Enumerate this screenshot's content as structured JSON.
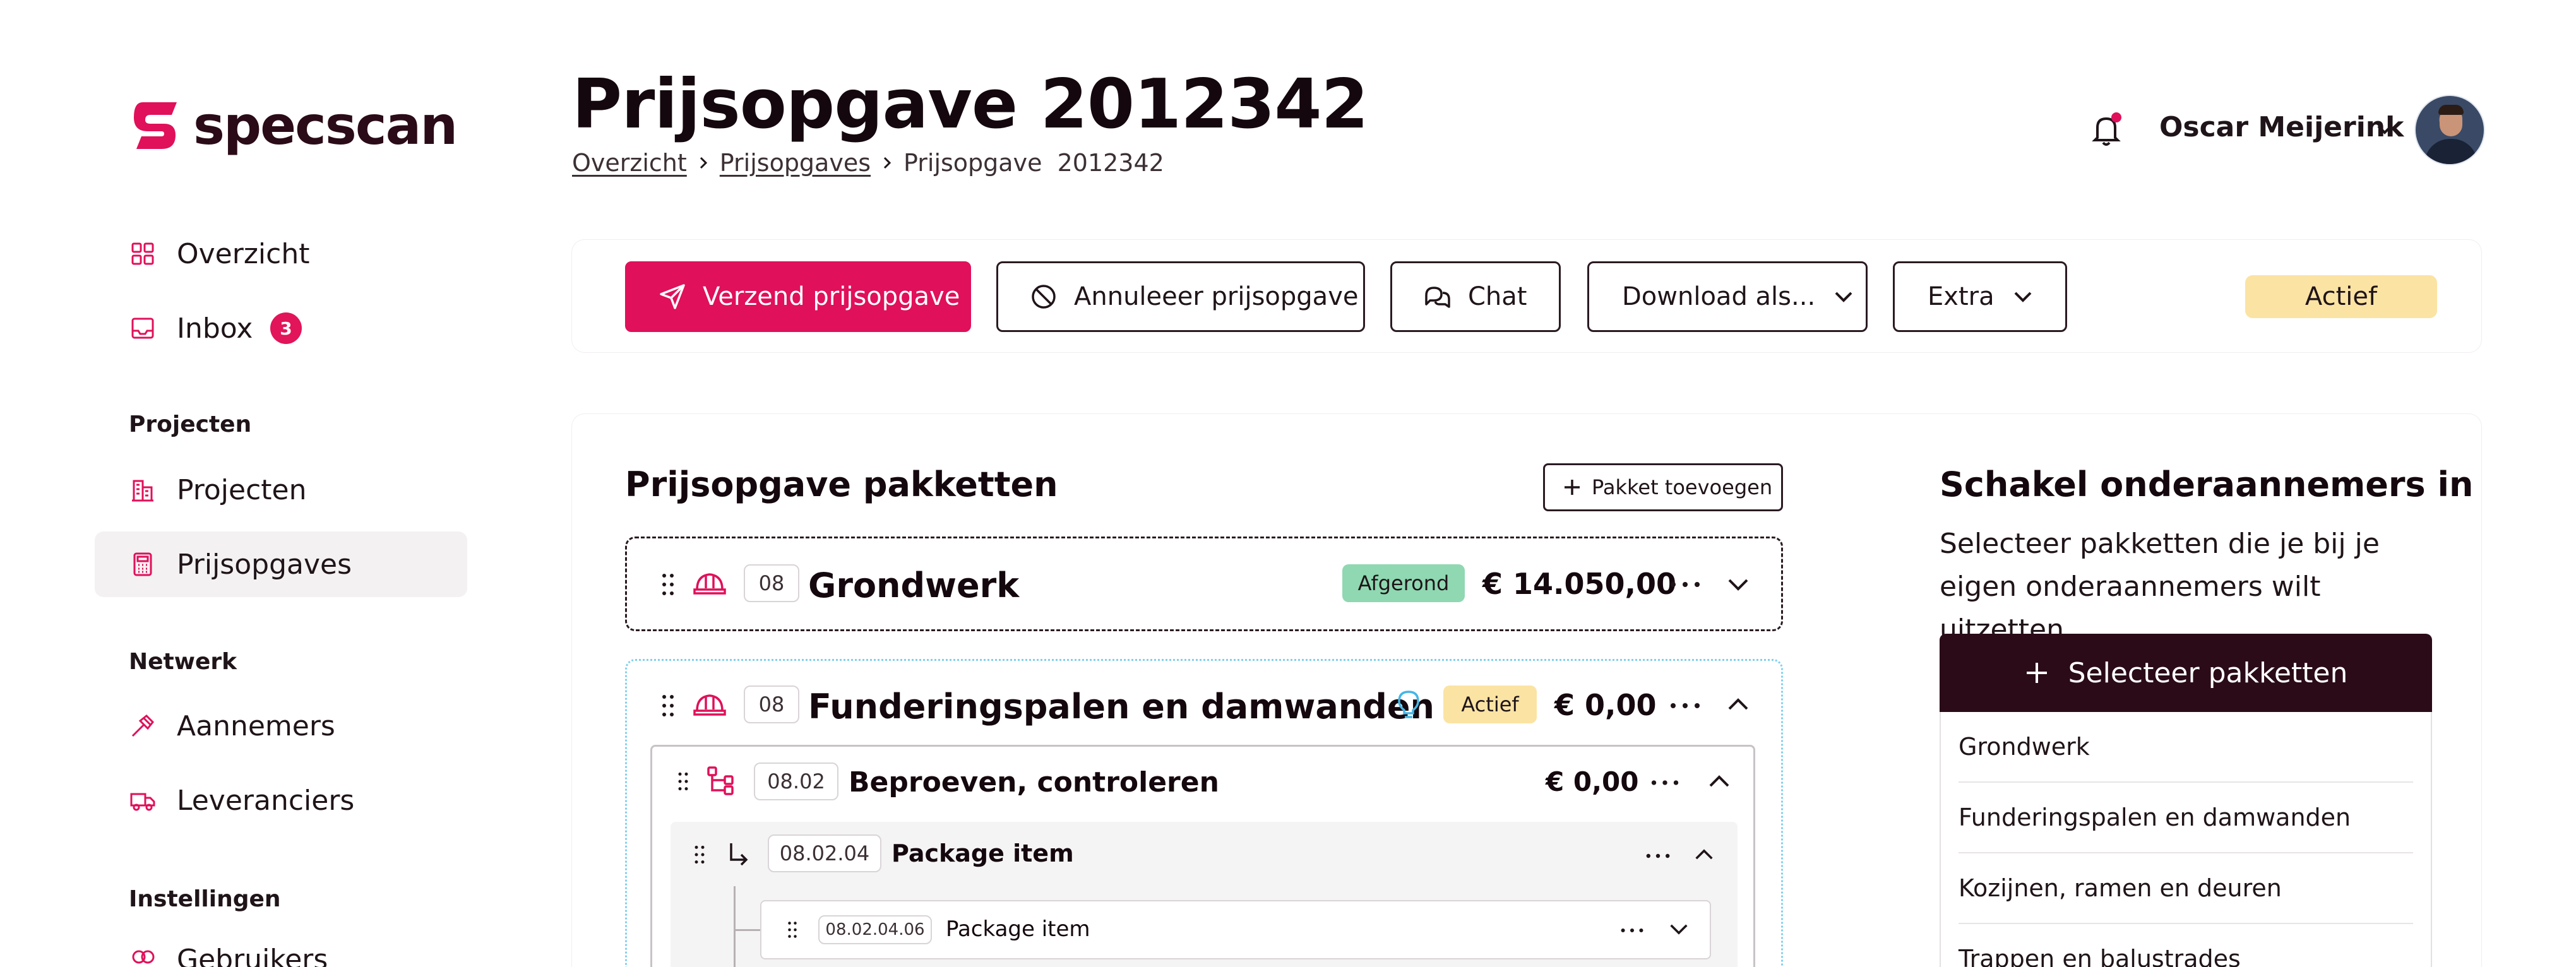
{
  "app": {
    "logo_text": "specscan"
  },
  "sidebar": {
    "items_top": [
      {
        "label": "Overzicht",
        "icon": "grid-icon"
      },
      {
        "label": "Inbox",
        "icon": "inbox-icon",
        "badge": "3"
      }
    ],
    "sections": [
      {
        "title": "Projecten",
        "items": [
          {
            "label": "Projecten",
            "icon": "buildings-icon"
          },
          {
            "label": "Prijsopgaves",
            "icon": "calculator-icon",
            "active": true
          }
        ]
      },
      {
        "title": "Netwerk",
        "items": [
          {
            "label": "Aannemers",
            "icon": "hammer-icon"
          },
          {
            "label": "Leveranciers",
            "icon": "truck-icon"
          }
        ]
      },
      {
        "title": "Instellingen",
        "items": [
          {
            "label": "Gebruikers",
            "icon": "users-icon"
          }
        ]
      }
    ]
  },
  "header": {
    "title": "Prijsopgave 2012342",
    "breadcrumb": [
      "Overzicht",
      "Prijsopgaves",
      "Prijsopgave  2012342"
    ],
    "user_name": "Oscar Meijerink"
  },
  "toolbar": {
    "send_label": "Verzend prijsopgave",
    "cancel_label": "Annuleeer prijsopgave",
    "chat_label": "Chat",
    "download_label": "Download als...",
    "extra_label": "Extra",
    "status_label": "Actief",
    "colors": {
      "primary": "#e0105a",
      "status_bg": "#fbe3a3"
    }
  },
  "packages": {
    "heading": "Prijsopgave pakketten",
    "add_label": "Pakket toevoegen",
    "rows": [
      {
        "code": "08",
        "name": "Grondwerk",
        "status": "Afgerond",
        "price": "€ 14.050,00",
        "expanded": false
      },
      {
        "code": "08",
        "name": "Funderingspalen en damwanden",
        "status": "Actief",
        "price": "€ 0,00",
        "expanded": true,
        "children": [
          {
            "code": "08.02",
            "name": "Beproeven, controleren",
            "price": "€ 0,00",
            "children": [
              {
                "code": "08.02.04",
                "name": "Package item",
                "children": [
                  {
                    "code": "08.02.04.06",
                    "name": "Package item"
                  }
                ]
              }
            ]
          }
        ]
      }
    ]
  },
  "subcontractors": {
    "heading": "Schakel onderaannemers in",
    "description": "Selecteer pakketten die je bij je eigen onderaannemers wilt uitzetten.",
    "select_label": "Selecteer pakketten",
    "list": [
      "Grondwerk",
      "Funderingspalen en damwanden",
      "Kozijnen, ramen en deuren",
      "Trappen en balustrades"
    ]
  }
}
